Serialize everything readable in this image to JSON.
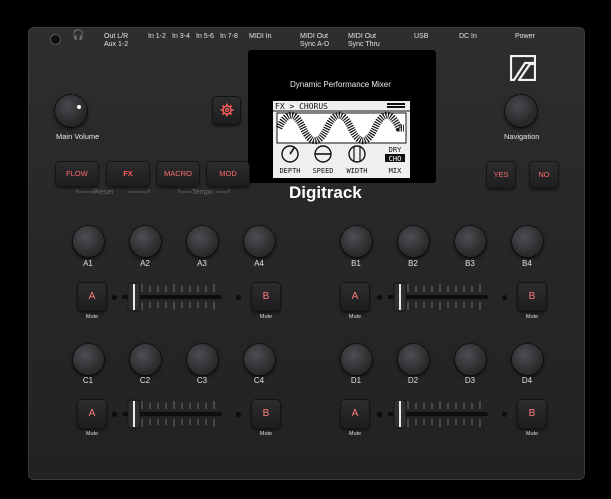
{
  "top_labels": {
    "out_lr": "Out L/R",
    "aux": "Aux 1-2",
    "in12": "In 1-2",
    "in34": "In 3-4",
    "in56": "In 5-6",
    "in78": "In 7-8",
    "midi_in": "MIDI In",
    "midi_out1": "MIDI Out",
    "sync_ad": "Sync A-D",
    "midi_out2": "MIDI Out",
    "sync_thru": "Sync Thru",
    "usb": "USB",
    "dc_in": "DC In",
    "power": "Power"
  },
  "main_volume_label": "Main Volume",
  "navigation_label": "Navigation",
  "screen": {
    "header": "Dynamic Performance Mixer",
    "lcd_title": "FX > CHORUS",
    "params": [
      "DEPTH",
      "SPEED",
      "WIDTH"
    ],
    "mix_top1": "DRY",
    "mix_top2": "CHO",
    "mix_label": "MIX"
  },
  "brand": "Digitrack",
  "mode_buttons": {
    "flow": "FLOW",
    "fx": "FX",
    "macro": "MACRO",
    "mod": "MOD"
  },
  "sub_labels": {
    "preset": "Preset",
    "tempo": "Tempo"
  },
  "yes_label": "YES",
  "no_label": "NO",
  "knob_labels": {
    "a": [
      "A1",
      "A2",
      "A3",
      "A4"
    ],
    "b": [
      "B1",
      "B2",
      "B3",
      "B4"
    ],
    "c": [
      "C1",
      "C2",
      "C3",
      "C4"
    ],
    "d": [
      "D1",
      "D2",
      "D3",
      "D4"
    ]
  },
  "channel_buttons": {
    "a": "A",
    "b": "B"
  },
  "mute_label": "Mute",
  "accent_color": "#ff6b6b"
}
